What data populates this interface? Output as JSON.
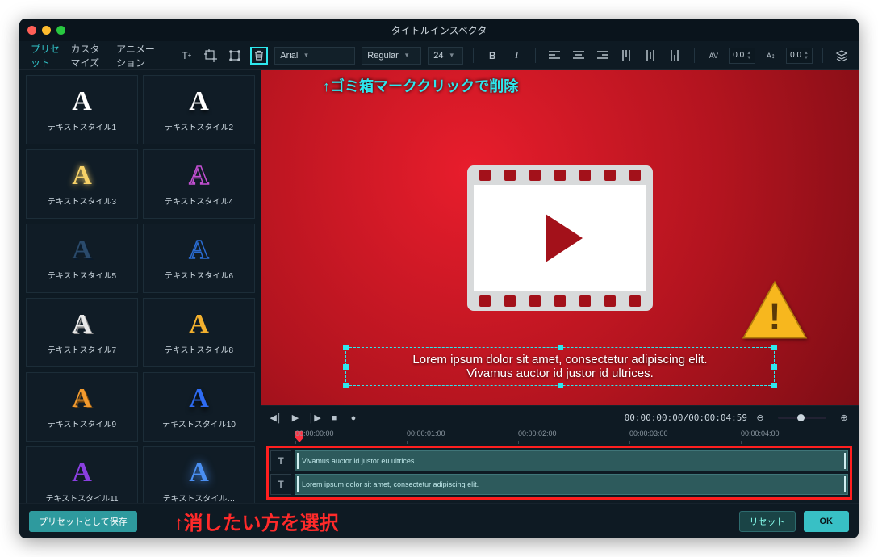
{
  "window": {
    "title": "タイトルインスペクタ"
  },
  "tabs": {
    "preset": "プリセット",
    "customize": "カスタマイズ",
    "animation": "アニメーション"
  },
  "toolbar": {
    "font": "Arial",
    "weight": "Regular",
    "size": "24",
    "spacing_h": "0.0",
    "spacing_v": "0.0"
  },
  "annotations": {
    "delete_hint": "↑ゴミ箱マーククリックで削除",
    "select_hint": "↑消したい方を選択"
  },
  "canvas_text": {
    "line1": "Lorem ipsum dolor sit amet, consectetur adipiscing elit.",
    "line2": "Vivamus auctor id justor id ultrices."
  },
  "presets": [
    {
      "label": "テキストスタイル1",
      "color": "#ffffff",
      "shadow": "none"
    },
    {
      "label": "テキストスタイル2",
      "color": "#ffffff",
      "shadow": "0 3px 4px rgba(0,0,0,0.6)"
    },
    {
      "label": "テキストスタイル3",
      "color": "#f7d268",
      "shadow": "0 0 8px #f7d268"
    },
    {
      "label": "テキストスタイル4",
      "color": "transparent",
      "stroke": "#c24fd1"
    },
    {
      "label": "テキストスタイル5",
      "color": "#2a4a6b",
      "shadow": "2px 2px 0 #0a1a2b"
    },
    {
      "label": "テキストスタイル6",
      "color": "transparent",
      "stroke": "#2a6bd1"
    },
    {
      "label": "テキストスタイル7",
      "color": "#e8e8e8",
      "shadow": "2px 2px 0 #888"
    },
    {
      "label": "テキストスタイル8",
      "color": "#f2b02e",
      "shadow": "0 0 0"
    },
    {
      "label": "テキストスタイル9",
      "color": "#f29a2e",
      "shadow": "2px 2px 0 #7a4a10"
    },
    {
      "label": "テキストスタイル10",
      "color": "#2e6bf2",
      "shadow": "0 4px 6px rgba(0,0,0,0.7)"
    },
    {
      "label": "テキストスタイル11",
      "color": "#8a3fe0",
      "shadow": "0 0 0"
    },
    {
      "label": "テキストスタイル…",
      "color": "#4a8ff2",
      "shadow": "0 0 12px #4a8ff2"
    }
  ],
  "playback": {
    "time": "00:00:00:00/00:00:04:59"
  },
  "ruler": [
    "00:00:00:00",
    "00:00:01:00",
    "00:00:02:00",
    "00:00:03:00",
    "00:00:04:00"
  ],
  "tracks": [
    {
      "head": "T",
      "text": "Vivamus auctor id justor eu ultrices."
    },
    {
      "head": "T",
      "text": "Lorem ipsum dolor sit amet, consectetur adipiscing elit."
    }
  ],
  "footer": {
    "save_preset": "プリセットとして保存",
    "reset": "リセット",
    "ok": "OK"
  }
}
